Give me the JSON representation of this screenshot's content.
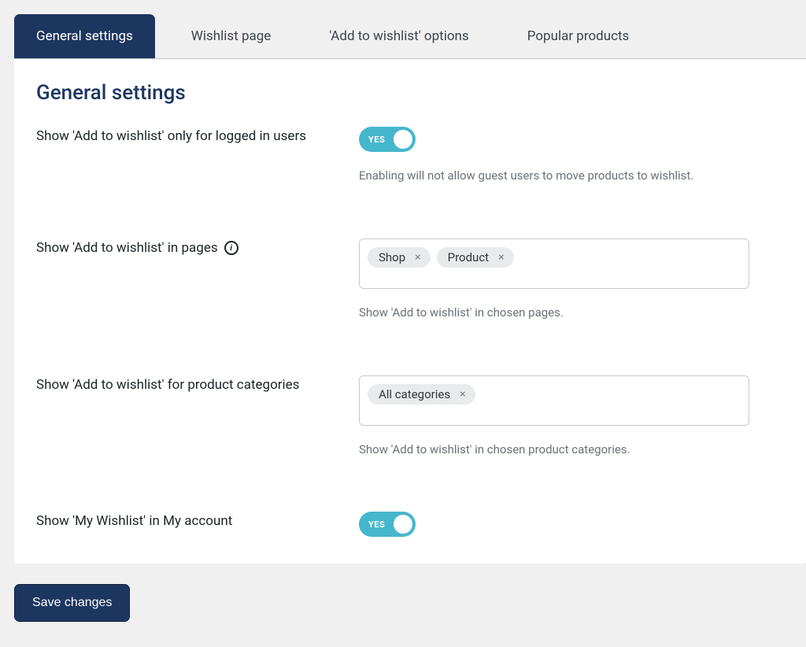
{
  "tabs": [
    {
      "label": "General settings",
      "active": true
    },
    {
      "label": "Wishlist page",
      "active": false
    },
    {
      "label": "'Add to wishlist' options",
      "active": false
    },
    {
      "label": "Popular products",
      "active": false
    }
  ],
  "panel": {
    "title": "General settings",
    "settings": {
      "logged_only": {
        "label": "Show 'Add to wishlist' only for logged in users",
        "toggle": "YES",
        "help": "Enabling will not allow guest users to move products to wishlist."
      },
      "pages": {
        "label": "Show 'Add to wishlist' in pages",
        "chips": [
          "Shop",
          "Product"
        ],
        "help": "Show 'Add to wishlist' in chosen pages."
      },
      "categories": {
        "label": "Show 'Add to wishlist' for product categories",
        "chips": [
          "All categories"
        ],
        "help": "Show 'Add to wishlist' in chosen product categories."
      },
      "my_account": {
        "label": "Show 'My Wishlist' in My account",
        "toggle": "YES"
      }
    }
  },
  "footer": {
    "save_label": "Save changes"
  }
}
